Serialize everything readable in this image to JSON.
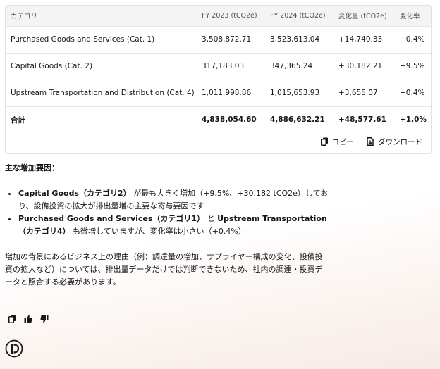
{
  "table": {
    "headers": [
      "カテゴリ",
      "FY 2023 (tCO2e)",
      "FY 2024 (tCO2e)",
      "変化量 (tCO2e)",
      "変化率"
    ],
    "rows": [
      {
        "category": "Purchased Goods and Services (Cat. 1)",
        "fy2023": "3,508,872.71",
        "fy2024": "3,523,613.04",
        "change": "+14,740.33",
        "rate": "+0.4%"
      },
      {
        "category": "Capital Goods (Cat. 2)",
        "fy2023": "317,183.03",
        "fy2024": "347,365.24",
        "change": "+30,182.21",
        "rate": "+9.5%"
      },
      {
        "category": "Upstream Transportation and Distribution (Cat. 4)",
        "fy2023": "1,011,998.86",
        "fy2024": "1,015,653.93",
        "change": "+3,655.07",
        "rate": "+0.4%"
      }
    ],
    "total": {
      "category": "合計",
      "fy2023": "4,838,054.60",
      "fy2024": "4,886,632.21",
      "change": "+48,577.61",
      "rate": "+1.0%"
    }
  },
  "toolbar": {
    "copy_label": "コピー",
    "download_label": "ダウンロード"
  },
  "answer": {
    "heading": "主な増加要因：",
    "bullets": [
      {
        "bold": "Capital Goods（カテゴリ2）",
        "text": " が最も大きく増加（+9.5%、+30,182 tCO2e）しており、設備投資の拡大が排出量増の主要な寄与要因です"
      },
      {
        "bold": "Purchased Goods and Services（カテゴリ1）",
        "mid": " と ",
        "bold2": "Upstream Transportation（カテゴリ4）",
        "text": " も微増していますが、変化率は小さい（+0.4%）"
      }
    ],
    "paragraph": "増加の背景にあるビジネス上の理由（例：調達量の増加、サプライヤー構成の変化、設備投資の拡大など）については、排出量データだけでは判断できないため、社内の調達・投資データと照合する必要があります。"
  },
  "icons": {
    "copy": "copy-icon",
    "download": "download-icon",
    "thumbs_up": "thumbs-up-icon",
    "thumbs_down": "thumbs-down-icon",
    "logo": "assistant-logo-icon"
  }
}
